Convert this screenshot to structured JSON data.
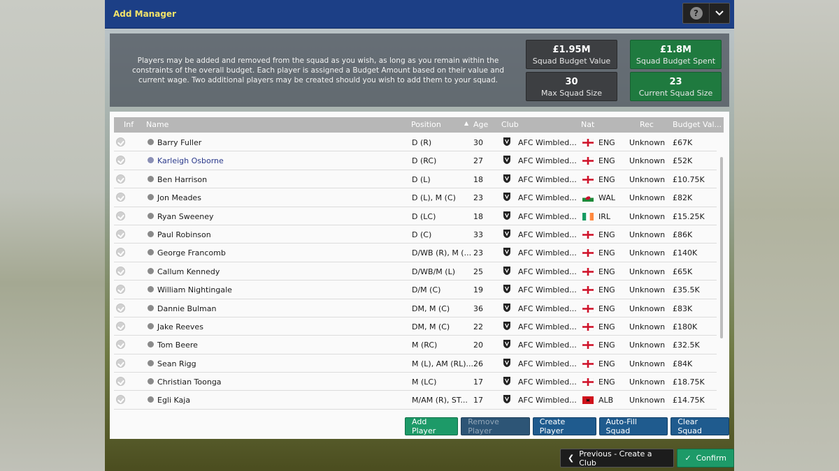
{
  "window": {
    "title": "Add Manager"
  },
  "info": {
    "description": "Players may be added and removed from the squad as you wish, as long as you remain within the constraints of the overall budget. Each player is assigned a Budget Amount based on their value and current wage. Two additional players may be created should you wish to add them to your squad."
  },
  "stats": {
    "squad_budget_value": {
      "value": "£1.95M",
      "label": "Squad Budget Value"
    },
    "squad_budget_spent": {
      "value": "£1.8M",
      "label": "Squad Budget Spent"
    },
    "max_squad_size": {
      "value": "30",
      "label": "Max Squad Size"
    },
    "current_squad_size": {
      "value": "23",
      "label": "Current Squad Size"
    }
  },
  "colors": {
    "accent_green": "#1d9a68",
    "title_yellow": "#f3e36a",
    "titlebar_blue": "#1c3f86"
  },
  "table": {
    "headers": {
      "inf": "Inf",
      "name": "Name",
      "position": "Position",
      "age": "Age",
      "club": "Club",
      "nat": "Nat",
      "rec": "Rec",
      "budget": "Budget Val..."
    },
    "rows": [
      {
        "name": "Barry Fuller",
        "position": "D (R)",
        "age": "30",
        "club": "AFC Wimbled...",
        "nat": "ENG",
        "rec": "Unknown",
        "budget": "£67K"
      },
      {
        "name": "Karleigh Osborne",
        "position": "D (RC)",
        "age": "27",
        "club": "AFC Wimbled...",
        "nat": "ENG",
        "rec": "Unknown",
        "budget": "£52K"
      },
      {
        "name": "Ben Harrison",
        "position": "D (L)",
        "age": "18",
        "club": "AFC Wimbled...",
        "nat": "ENG",
        "rec": "Unknown",
        "budget": "£10.75K"
      },
      {
        "name": "Jon Meades",
        "position": "D (L), M (C)",
        "age": "23",
        "club": "AFC Wimbled...",
        "nat": "WAL",
        "rec": "Unknown",
        "budget": "£82K"
      },
      {
        "name": "Ryan Sweeney",
        "position": "D (LC)",
        "age": "18",
        "club": "AFC Wimbled...",
        "nat": "IRL",
        "rec": "Unknown",
        "budget": "£15.25K"
      },
      {
        "name": "Paul Robinson",
        "position": "D (C)",
        "age": "33",
        "club": "AFC Wimbled...",
        "nat": "ENG",
        "rec": "Unknown",
        "budget": "£86K"
      },
      {
        "name": "George Francomb",
        "position": "D/WB (R), M (...",
        "age": "23",
        "club": "AFC Wimbled...",
        "nat": "ENG",
        "rec": "Unknown",
        "budget": "£140K"
      },
      {
        "name": "Callum Kennedy",
        "position": "D/WB/M (L)",
        "age": "25",
        "club": "AFC Wimbled...",
        "nat": "ENG",
        "rec": "Unknown",
        "budget": "£65K"
      },
      {
        "name": "William Nightingale",
        "position": "D/M (C)",
        "age": "19",
        "club": "AFC Wimbled...",
        "nat": "ENG",
        "rec": "Unknown",
        "budget": "£35.5K"
      },
      {
        "name": "Dannie Bulman",
        "position": "DM, M (C)",
        "age": "36",
        "club": "AFC Wimbled...",
        "nat": "ENG",
        "rec": "Unknown",
        "budget": "£83K"
      },
      {
        "name": "Jake Reeves",
        "position": "DM, M (C)",
        "age": "22",
        "club": "AFC Wimbled...",
        "nat": "ENG",
        "rec": "Unknown",
        "budget": "£180K"
      },
      {
        "name": "Tom Beere",
        "position": "M (RC)",
        "age": "20",
        "club": "AFC Wimbled...",
        "nat": "ENG",
        "rec": "Unknown",
        "budget": "£32.5K"
      },
      {
        "name": "Sean Rigg",
        "position": "M (L), AM (RL)...",
        "age": "26",
        "club": "AFC Wimbled...",
        "nat": "ENG",
        "rec": "Unknown",
        "budget": "£84K"
      },
      {
        "name": "Christian Toonga",
        "position": "M (LC)",
        "age": "17",
        "club": "AFC Wimbled...",
        "nat": "ENG",
        "rec": "Unknown",
        "budget": "£18.75K"
      },
      {
        "name": "Egli Kaja",
        "position": "M/AM (R), ST...",
        "age": "17",
        "club": "AFC Wimbled...",
        "nat": "ALB",
        "rec": "Unknown",
        "budget": "£14.75K"
      }
    ]
  },
  "actions": {
    "add_player": "Add Player",
    "remove_player": "Remove Player",
    "create_player": "Create Player",
    "auto_fill": "Auto-Fill Squad",
    "clear_squad": "Clear Squad"
  },
  "footer": {
    "previous": "Previous - Create a Club",
    "confirm": "Confirm"
  }
}
